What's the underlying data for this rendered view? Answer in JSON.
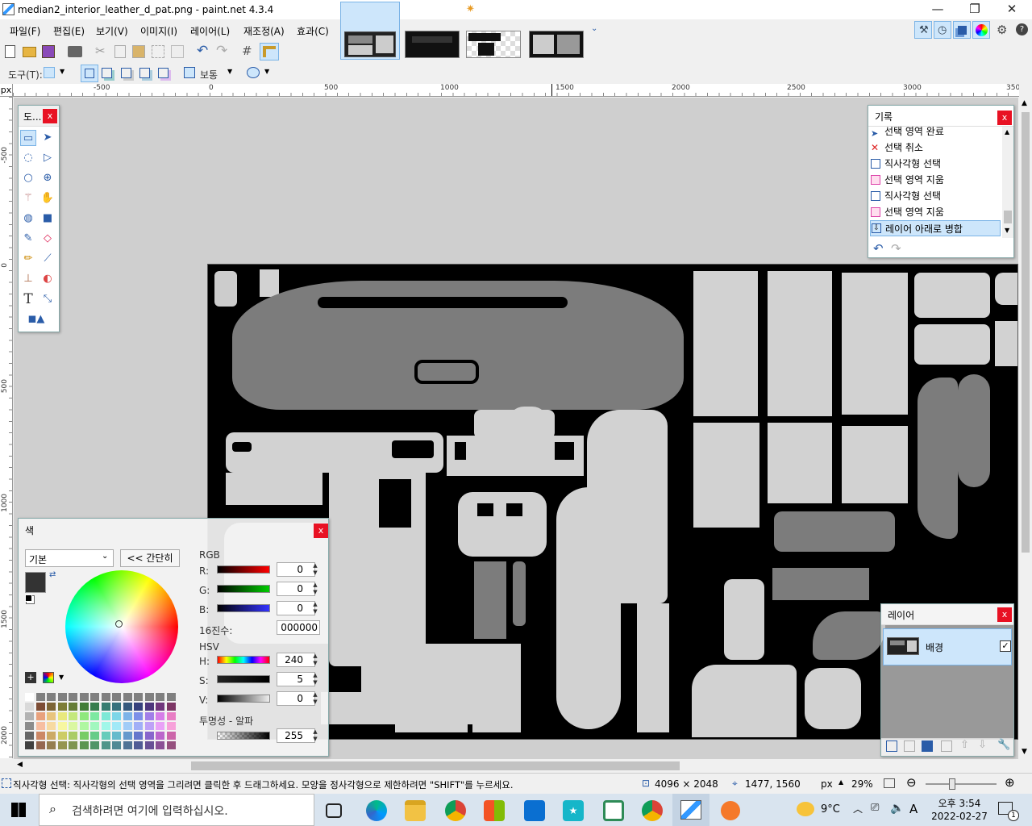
{
  "window": {
    "title": "median2_interior_leather_d_pat.png - paint.net 4.3.4",
    "min": "—",
    "max": "❐",
    "close": "✕"
  },
  "menu": [
    "파일(F)",
    "편집(E)",
    "보기(V)",
    "이미지(I)",
    "레이어(L)",
    "재조정(A)",
    "효과(C)"
  ],
  "toolbar2": {
    "tool_label": "도구(T):",
    "blend_label": "보통"
  },
  "ruler_h": [
    "-500",
    "0",
    "500",
    "1000",
    "1500",
    "2000",
    "2500",
    "3000",
    "350"
  ],
  "ruler_v": [
    "-500",
    "0",
    "500",
    "1000",
    "1500",
    "2000"
  ],
  "ruler_unit": "px",
  "tools_panel": {
    "title": "도..."
  },
  "history_panel": {
    "title": "기록",
    "items": [
      "선택 영역 완료",
      "선택 취소",
      "직사각형 선택",
      "선택 영역 지움",
      "직사각형 선택",
      "선택 영역 지움",
      "레이어 아래로 병합"
    ]
  },
  "layers_panel": {
    "title": "레이어",
    "layer_name": "배경"
  },
  "color_panel": {
    "title": "색",
    "palette_select": "기본",
    "less_button": "<< 간단히",
    "rgb_label": "RGB",
    "r_label": "R:",
    "r": "0",
    "g_label": "G:",
    "g": "0",
    "b_label": "B:",
    "b": "0",
    "hex_label": "16진수:",
    "hex": "000000",
    "hsv_label": "HSV",
    "h_label": "H:",
    "h": "240",
    "s_label": "S:",
    "s": "5",
    "v_label": "V:",
    "v": "0",
    "alpha_label": "투명성 - 알파",
    "alpha": "255",
    "primary_color": "#333333"
  },
  "status": {
    "hint": "직사각형 선택: 직사각형의 선택 영역을 그리려면 클릭한 후 드래그하세요. 모양을 정사각형으로 제한하려면 \"SHIFT\"를 누르세요.",
    "image_size": "4096 × 2048",
    "cursor_pos": "1477, 1560",
    "unit": "px",
    "zoom": "29%",
    "zoom_level": 0.29
  },
  "taskbar": {
    "search_placeholder": "검색하려면 여기에 입력하십시오.",
    "weather": "9°C",
    "ime": "A",
    "time": "오후 3:54",
    "date": "2022-02-27",
    "notif_count": "1"
  }
}
